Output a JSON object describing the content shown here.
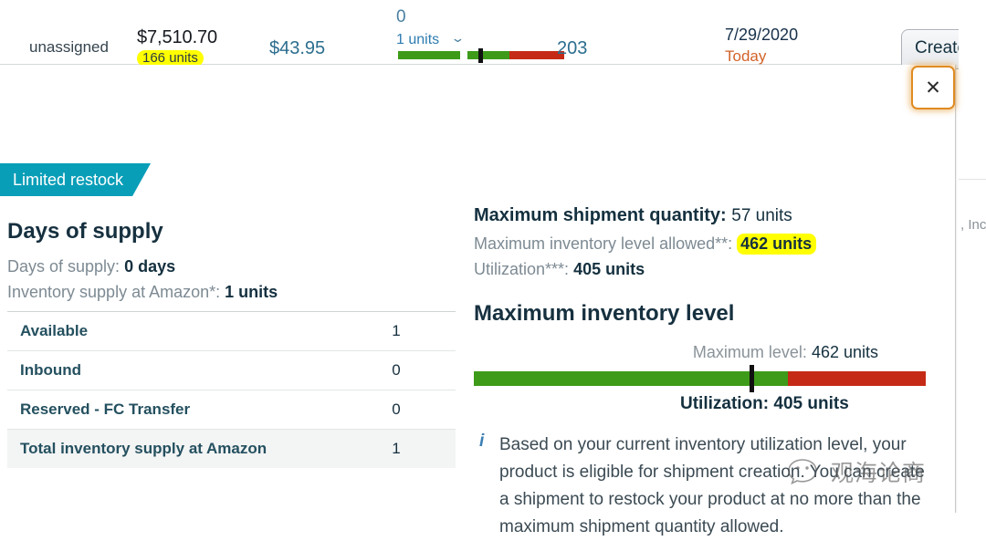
{
  "header": {
    "assignment": "unassigned",
    "price": "$7,510.70",
    "price_units": "166 units",
    "secondary_price": "$43.95",
    "inbound_count": "0",
    "inbound_units": "1 units",
    "chevron": "⌄",
    "supply_number": "203",
    "date": "7/29/2020",
    "date_note": "Today",
    "create_button": "Create sh",
    "mini_bar": {
      "green_color": "#3d9b19",
      "red_color": "#c52a16",
      "tick_color": "#111111"
    }
  },
  "dialog": {
    "close_label": "✕",
    "edge_text": ", Inc"
  },
  "left": {
    "badge": "Limited restock",
    "title": "Days of supply",
    "days_of_supply_label": "Days of supply:",
    "days_of_supply_value": "0 days",
    "inventory_supply_label": "Inventory supply at Amazon*:",
    "inventory_supply_value": "1 units",
    "rows": [
      {
        "label": "Available",
        "value": "1"
      },
      {
        "label": "Inbound",
        "value": "0"
      },
      {
        "label": "Reserved - FC Transfer",
        "value": "0"
      },
      {
        "label": "Total inventory supply at Amazon",
        "value": "1"
      }
    ]
  },
  "right": {
    "max_shipment_label": "Maximum shipment quantity:",
    "max_shipment_value": "57 units",
    "max_inventory_label": "Maximum inventory level allowed**:",
    "max_inventory_value": "462 units",
    "utilization_label": "Utilization***:",
    "utilization_value": "405 units",
    "chart_title": "Maximum inventory level",
    "note_icon": "i",
    "note_text": "Based on your current inventory utilization level, your product is eligible for shipment creation. You can create a shipment to restock your product at no more than the maximum shipment quantity allowed."
  },
  "chart_data": {
    "type": "bar",
    "title": "Maximum inventory level",
    "orientation": "horizontal",
    "max_level_label": "Maximum level:",
    "max_level_value": "462 units",
    "max_level": 462,
    "utilization_label": "Utilization:",
    "utilization_value": "405 units",
    "utilization": 405,
    "axis_max": 665,
    "segments": [
      {
        "name": "within allowed level",
        "color": "#3d9b19",
        "from": 0,
        "to": 462
      },
      {
        "name": "above allowed level",
        "color": "#c52a16",
        "from": 462,
        "to": 665
      }
    ],
    "marker": {
      "name": "current utilization",
      "value": 405,
      "color": "#111111"
    },
    "grid": false,
    "legend": "none",
    "xlabel": "",
    "ylabel": "units"
  },
  "watermark": {
    "text": "观海论商",
    "icon": "wechat-icon"
  }
}
